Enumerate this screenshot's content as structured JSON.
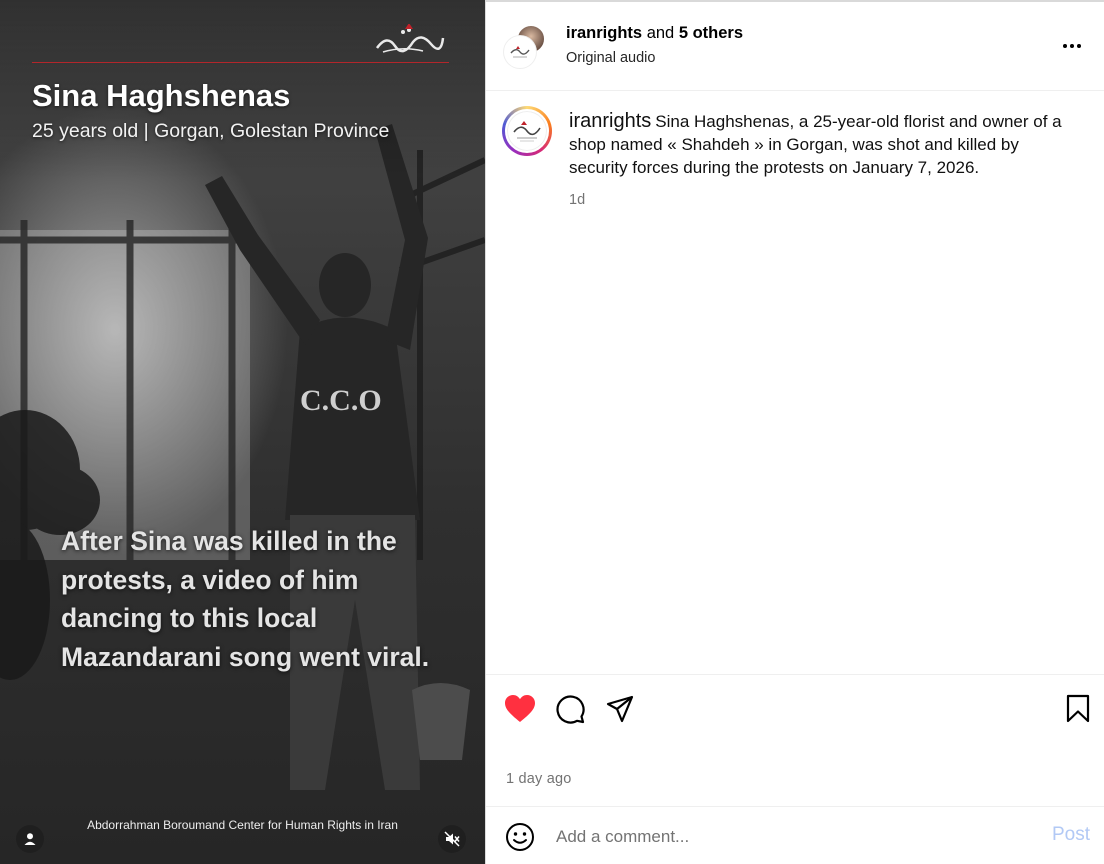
{
  "video": {
    "title": "Sina Haghshenas",
    "subtitle": "25 years old | Gorgan, Golestan Province",
    "caption": "After Sina was killed in the protests, a video of him dancing to this local Mazandarani song went viral.",
    "credit": "Abdorrahman Boroumand Center for Human Rights in Iran",
    "watermark_icon": "persian-calligraphy-logo",
    "user_tag_icon": "person-icon",
    "mute_icon": "speaker-muted-icon"
  },
  "header": {
    "username": "iranrights",
    "and_text": "and",
    "others": "5 others",
    "audio": "Original audio",
    "more_icon": "more-options-icon"
  },
  "caption": {
    "username": "iranrights",
    "text": "Sina Haghshenas, a 25-year-old florist and owner of a shop named « Shahdeh » in Gorgan, was shot and killed by security forces during the protests on January 7, 2026.",
    "time": "1d"
  },
  "actions": {
    "like_icon": "heart-filled-icon",
    "like_color": "#ff3040",
    "comment_icon": "comment-icon",
    "share_icon": "send-icon",
    "save_icon": "bookmark-icon"
  },
  "post_time": "1 day ago",
  "comment": {
    "placeholder": "Add a comment...",
    "post_label": "Post",
    "emoji_icon": "emoji-icon"
  }
}
